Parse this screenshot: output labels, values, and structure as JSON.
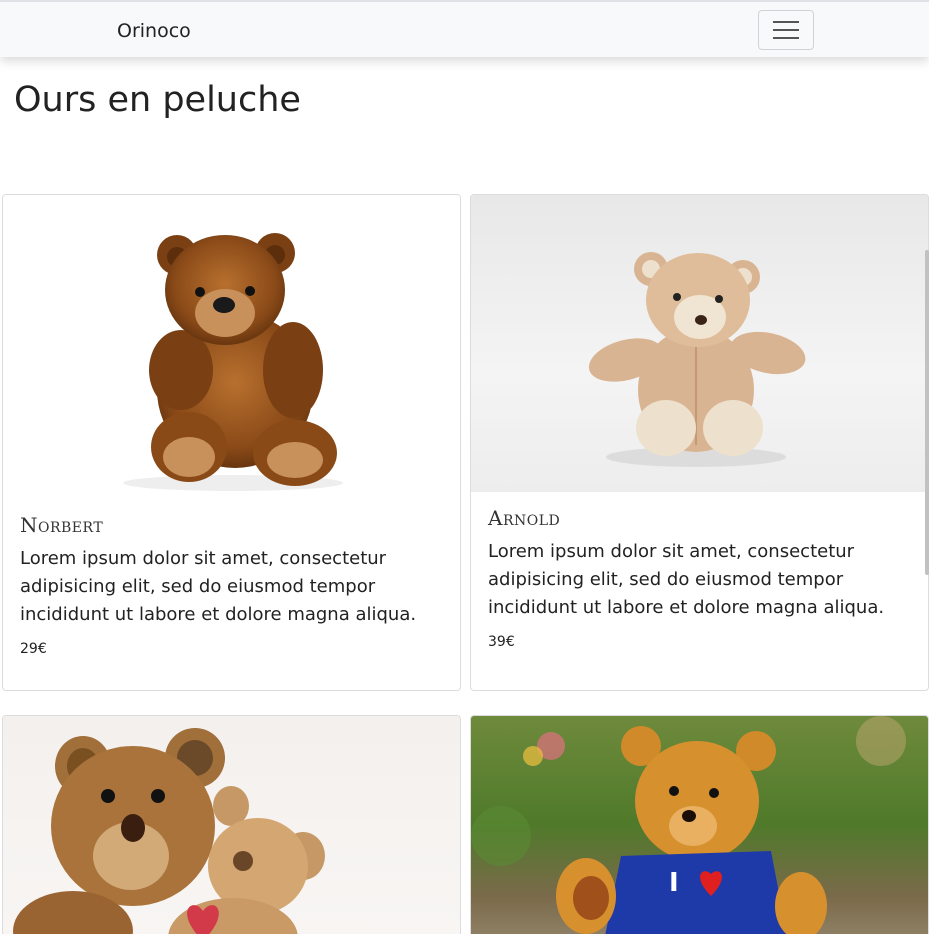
{
  "navbar": {
    "brand": "Orinoco",
    "toggle_icon": "hamburger-icon"
  },
  "page": {
    "title": "Ours en peluche"
  },
  "products": [
    {
      "name": "Norbert",
      "description": "Lorem ipsum dolor sit amet, consectetur adipisicing elit, sed do eiusmod tempor incididunt ut labore et dolore magna aliqua.",
      "price": "29€"
    },
    {
      "name": "Arnold",
      "description": "Lorem ipsum dolor sit amet, consectetur adipisicing elit, sed do eiusmod tempor incididunt ut labore et dolore magna aliqua.",
      "price": "39€"
    }
  ],
  "colors": {
    "navbar_bg": "#f8f9fa",
    "card_border": "#dcdcdc",
    "text": "#212529"
  }
}
